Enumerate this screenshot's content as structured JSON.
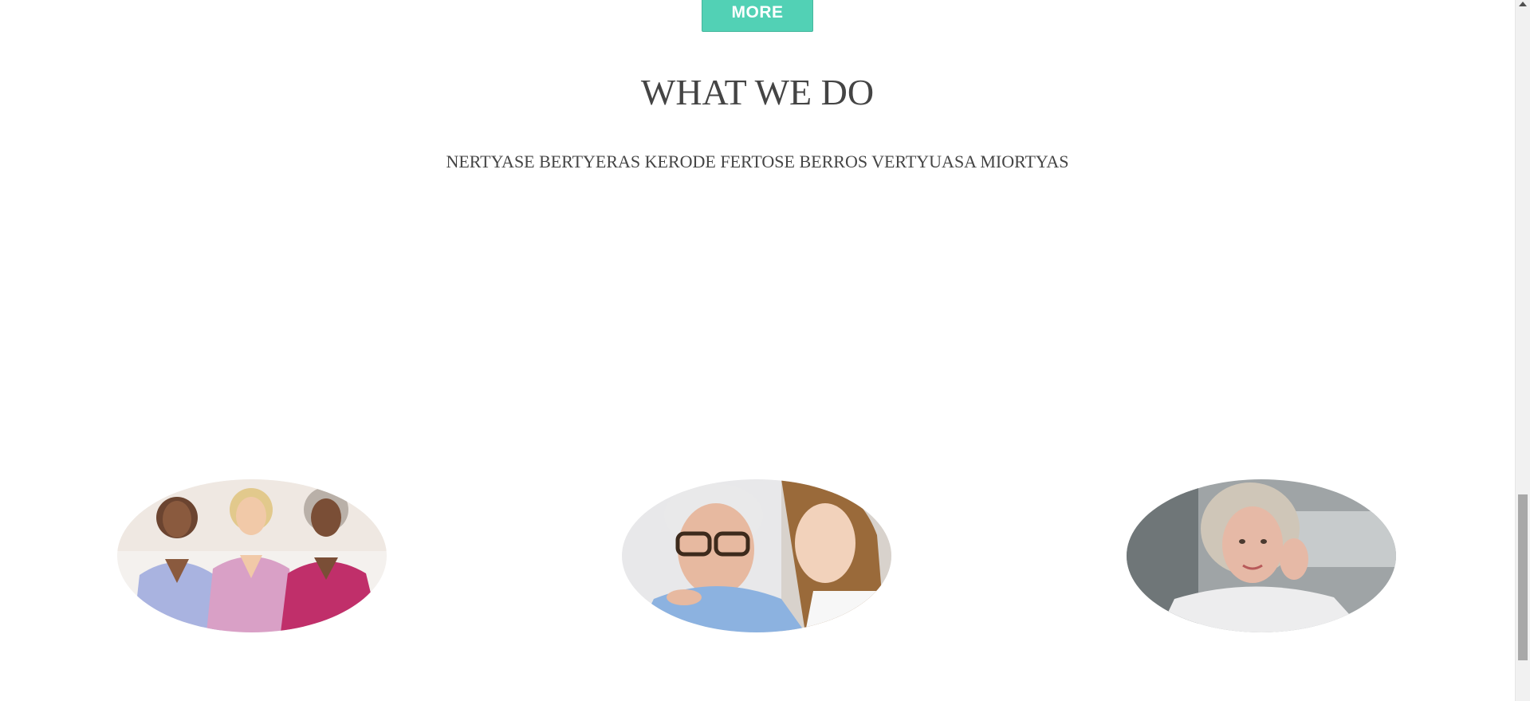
{
  "more_button": {
    "label": "MORE"
  },
  "section": {
    "title": "WHAT WE DO",
    "subtitle": "NERTYASE BERTYERAS KERODE FERTOSE BERROS VERTYUASA MIORTYAS"
  },
  "photos": [
    {
      "name": "three-nurses-photo"
    },
    {
      "name": "elderly-man-with-caregiver-photo"
    },
    {
      "name": "smiling-senior-woman-photo"
    }
  ],
  "colors": {
    "accent": "#52d1b5",
    "text": "#444444",
    "background": "#ffffff"
  }
}
